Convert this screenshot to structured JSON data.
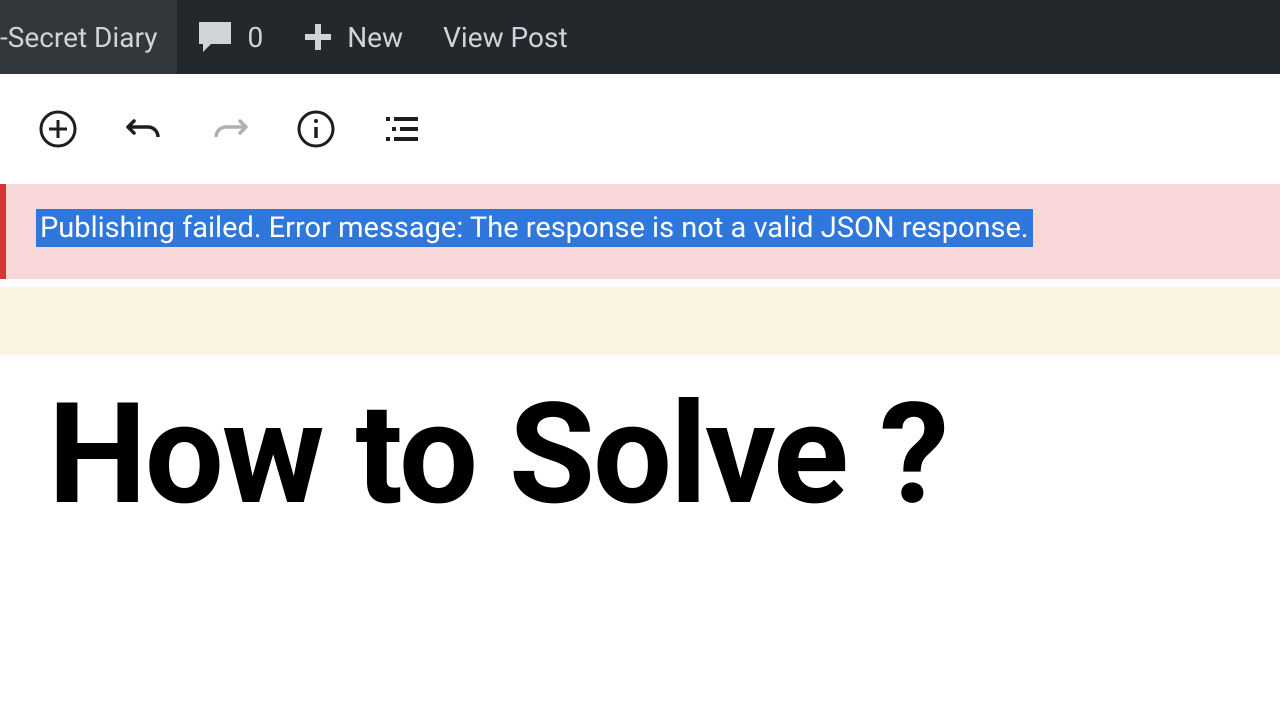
{
  "adminBar": {
    "siteTitle": "-Secret Diary",
    "commentsCount": "0",
    "newLabel": "New",
    "viewPostLabel": "View Post"
  },
  "toolbar": {
    "addTooltip": "Add block",
    "undoTooltip": "Undo",
    "redoTooltip": "Redo",
    "infoTooltip": "Details",
    "outlineTooltip": "Outline"
  },
  "error": {
    "message": "Publishing failed. Error message: The response is not a valid JSON response."
  },
  "headline": "How to Solve ?"
}
